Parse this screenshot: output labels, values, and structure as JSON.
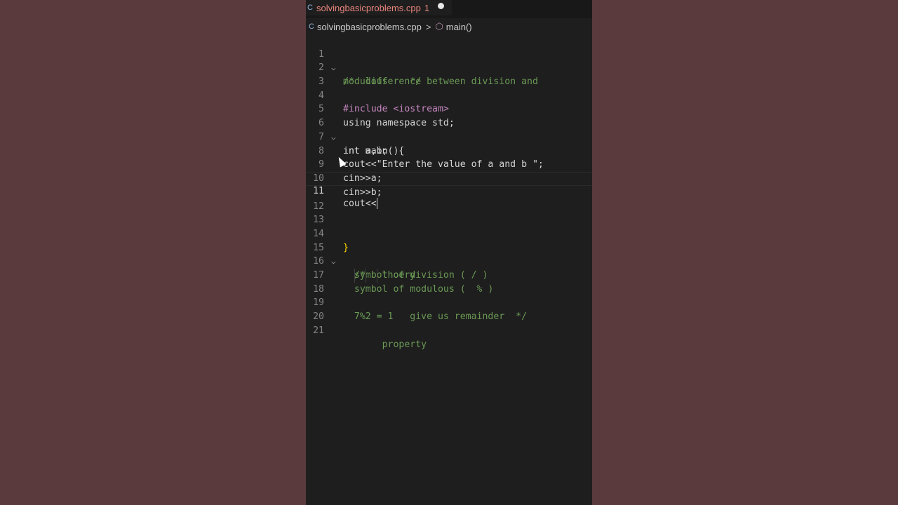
{
  "tab": {
    "filename": "solvingbasicproblems.cpp",
    "badge": "1",
    "icon": "cpp-file-icon",
    "modified": true
  },
  "breadcrumb": {
    "file": "solvingbasicproblems.cpp",
    "symbol": "main()",
    "separator": ">"
  },
  "editor": {
    "current_line": 11,
    "lines": [
      {
        "n": "1",
        "text": "/*  difference between division and"
      },
      {
        "n": "2",
        "text": "modulous    */"
      },
      {
        "n": "3",
        "text": ""
      },
      {
        "n": "4",
        "text": "#include <iostream>"
      },
      {
        "n": "5",
        "text": "using namespace std;"
      },
      {
        "n": "6",
        "text": "int main(){"
      },
      {
        "n": "7",
        "text": "int a,b;"
      },
      {
        "n": "8",
        "text": "cout<<\"Enter the value of a and b \";"
      },
      {
        "n": "9",
        "text": "cin>>a;"
      },
      {
        "n": "10",
        "text": "cin>>b;"
      },
      {
        "n": "11",
        "text": "cout<<"
      },
      {
        "n": "12",
        "text": ""
      },
      {
        "n": "13",
        "text": ""
      },
      {
        "n": "14",
        "text": "}"
      },
      {
        "n": "15",
        "text": "  /*   thoery"
      },
      {
        "n": "16",
        "text": "  symbol of division ( / )"
      },
      {
        "n": "17",
        "text": "  symbol of modulous (  % )"
      },
      {
        "n": "18",
        "text": "       property"
      },
      {
        "n": "19",
        "text": "  7%2 = 1   give us remainder  */"
      },
      {
        "n": "20",
        "text": ""
      },
      {
        "n": "21",
        "text": ""
      }
    ]
  },
  "colors": {
    "background": "#5a3a3c",
    "editor_bg": "#1e1e1e",
    "comment": "#6a9955",
    "keyword": "#c586c0",
    "type": "#569cd6",
    "string": "#ce9178"
  }
}
